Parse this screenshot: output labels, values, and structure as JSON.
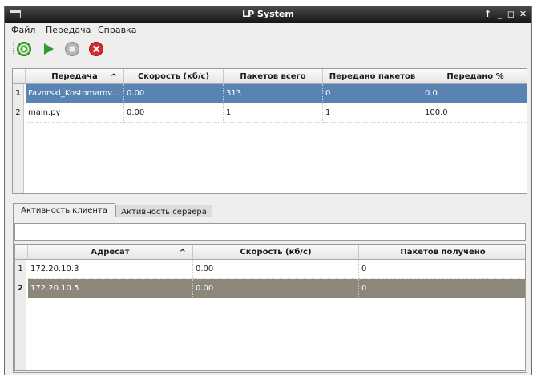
{
  "window": {
    "title": "LP System",
    "controls": [
      "↑",
      "_",
      "◻",
      "✕"
    ]
  },
  "menu": [
    "Файл",
    "Передача",
    "Справка"
  ],
  "toolbar": {
    "icons": [
      "start-all-icon",
      "play-icon",
      "stop-icon",
      "cancel-icon"
    ],
    "colors": {
      "start": "#4caf3a",
      "play": "#2f9a2f",
      "stop": "#9a9a9a",
      "cancel": "#d72b2b"
    }
  },
  "transfers": {
    "columns": [
      "Передача",
      "Скорость (кб/с)",
      "Пакетов всего",
      "Передано пакетов",
      "Передано %"
    ],
    "sort_indicator": "^",
    "rows": [
      {
        "num": "1",
        "cells": [
          "Favorski_Kostomarov...",
          "0.00",
          "313",
          "0",
          "0.0"
        ],
        "selected": true
      },
      {
        "num": "2",
        "cells": [
          "main.py",
          "0.00",
          "1",
          "1",
          "100.0"
        ],
        "selected": false
      }
    ],
    "selection_color": "#5983b3"
  },
  "tabs": [
    "Активность клиента",
    "Активность сервера"
  ],
  "active_tab": 0,
  "filter": {
    "value": ""
  },
  "recipients": {
    "columns": [
      "Адресат",
      "Скорость (кб/с)",
      "Пакетов получено"
    ],
    "sort_indicator": "^",
    "rows": [
      {
        "num": "1",
        "cells": [
          "172.20.10.3",
          "0.00",
          "0"
        ],
        "selected": false
      },
      {
        "num": "2",
        "cells": [
          "172.20.10.5",
          "0.00",
          "0"
        ],
        "selected": true
      }
    ],
    "selection_color": "#8b8779"
  }
}
